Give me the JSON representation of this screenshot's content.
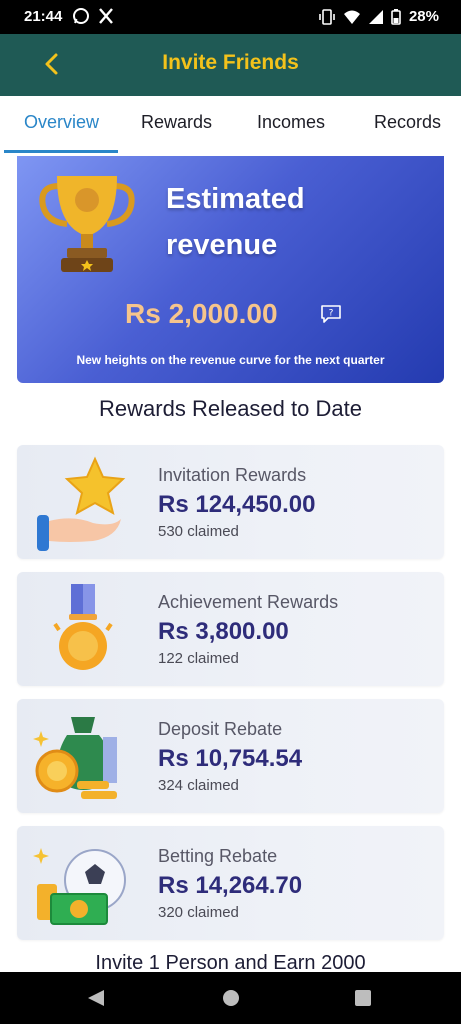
{
  "status_bar": {
    "time": "21:44",
    "battery": "28%",
    "left_icons": [
      "whatsapp-icon",
      "x-icon"
    ],
    "right_icons": [
      "vibrate-icon",
      "wifi-icon",
      "signal-icon",
      "battery-icon"
    ]
  },
  "header": {
    "title": "Invite Friends",
    "back_icon": "chevron-left-icon"
  },
  "tabs": [
    {
      "label": "Overview",
      "active": true
    },
    {
      "label": "Rewards",
      "active": false
    },
    {
      "label": "Incomes",
      "active": false
    },
    {
      "label": "Records",
      "active": false
    }
  ],
  "hero": {
    "heading": "Estimated revenue",
    "amount": "Rs 2,000.00",
    "caption": "New heights on the revenue curve for the next quarter",
    "help_icon": "question-bubble-icon"
  },
  "rewards_title": "Rewards Released to Date",
  "rewards": [
    {
      "name": "Invitation Rewards",
      "value": "Rs 124,450.00",
      "claimed": "530 claimed",
      "icon": "star-hand-icon"
    },
    {
      "name": "Achievement Rewards",
      "value": "Rs 3,800.00",
      "claimed": "122 claimed",
      "icon": "medal-icon"
    },
    {
      "name": "Deposit Rebate",
      "value": "Rs 10,754.54",
      "claimed": "324 claimed",
      "icon": "money-bag-icon"
    },
    {
      "name": "Betting Rebate",
      "value": "Rs 14,264.70",
      "claimed": "320 claimed",
      "icon": "football-cash-icon"
    }
  ],
  "footer_text": "Invite 1 Person and Earn 2000",
  "nav_bar": [
    "back-triangle-icon",
    "home-circle-icon",
    "recents-square-icon"
  ],
  "colors": {
    "header_bg": "#1f5a55",
    "header_title": "#f3c21b",
    "tab_active": "#2a86c8",
    "amount": "#f6c58c",
    "value_text": "#2e2c7a"
  }
}
